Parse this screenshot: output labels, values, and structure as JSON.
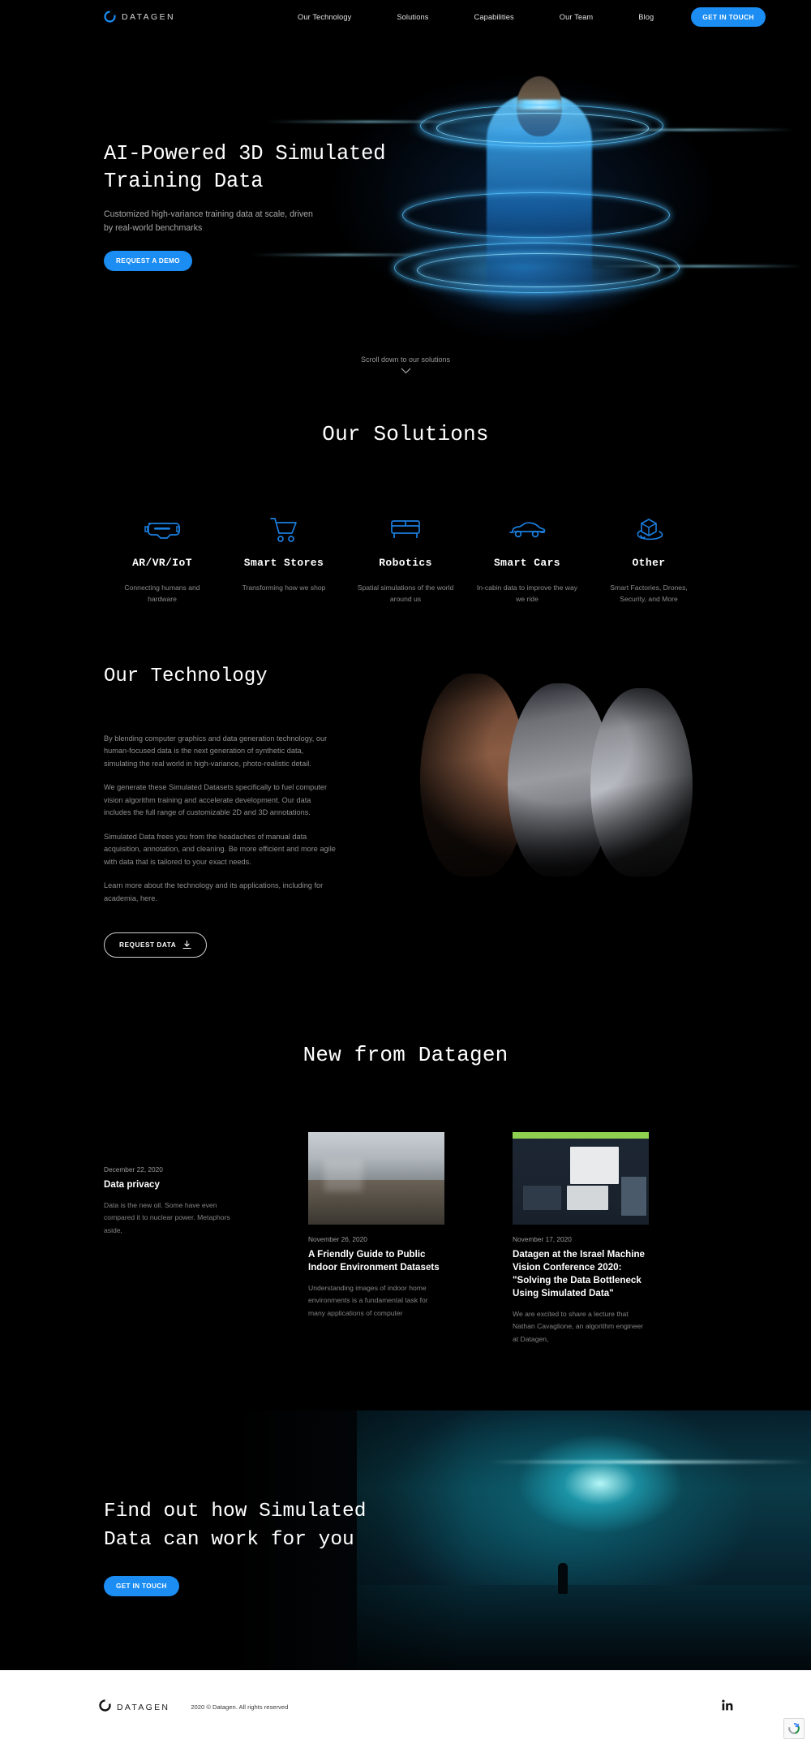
{
  "brand": {
    "name": "DATAGEN",
    "logo_icon": "datagen-ring-logo"
  },
  "nav": {
    "links": [
      {
        "label": "Our Technology"
      },
      {
        "label": "Solutions"
      },
      {
        "label": "Capabilities"
      },
      {
        "label": "Our Team"
      },
      {
        "label": "Blog"
      }
    ],
    "cta_label": "GET IN TOUCH"
  },
  "hero": {
    "title_line1": "AI-Powered 3D Simulated",
    "title_line2": "Training Data",
    "sub_line1": "Customized high-variance training data at scale, driven",
    "sub_line2": "by real-world benchmarks",
    "button_label": "REQUEST A DEMO",
    "scroll_label": "Scroll down to our solutions",
    "scroll_icon": "chevron-down-icon"
  },
  "solutions": {
    "title": "Our Solutions",
    "items": [
      {
        "icon": "vr-headset-icon",
        "name": "AR/VR/IoT",
        "desc": "Connecting humans and hardware"
      },
      {
        "icon": "shopping-cart-icon",
        "name": "Smart Stores",
        "desc": "Transforming how we shop"
      },
      {
        "icon": "sofa-icon",
        "name": "Robotics",
        "desc": "Spatial simulations of the world around us"
      },
      {
        "icon": "car-icon",
        "name": "Smart Cars",
        "desc": "In-cabin data to improve the way we ride"
      },
      {
        "icon": "cube-rotate-icon",
        "name": "Other",
        "desc": "Smart Factories, Drones, Security, and More"
      }
    ]
  },
  "technology": {
    "title": "Our Technology",
    "paragraphs": [
      "By blending computer graphics and data generation technology, our human-focused data is the next generation of synthetic data, simulating the real world in high-variance, photo-realistic detail.",
      "We generate these Simulated Datasets specifically to fuel computer vision algorithm training and accelerate development. Our data includes the full range of customizable 2D and 3D annotations.",
      "Simulated Data frees you from the headaches of manual data acquisition, annotation, and cleaning. Be more efficient and more agile with data that is tailored to your exact needs.",
      "Learn more about the technology and its applications, including for academia, here."
    ],
    "button_label": "REQUEST DATA",
    "button_icon": "download-icon"
  },
  "news": {
    "title": "New from Datagen",
    "cards": [
      {
        "date": "December 22, 2020",
        "title": "Data privacy",
        "excerpt": "Data is the new oil. Some have even compared it to nuclear power. Metaphors aside,",
        "has_thumb": false
      },
      {
        "date": "November 26, 2020",
        "title": "A Friendly Guide to Public Indoor Environment Datasets",
        "excerpt": "Understanding images of indoor home environments is a fundamental task for many applications of computer",
        "has_thumb": true,
        "thumb_kind": "indoor-room-photo"
      },
      {
        "date": "November 17, 2020",
        "title": "Datagen at the Israel Machine Vision Conference 2020: \"Solving the Data Bottleneck Using Simulated Data\"",
        "excerpt": "We are excited to share a lecture that Nathan Cavaglione, an algorithm engineer at Datagen,",
        "has_thumb": true,
        "thumb_kind": "conference-slide-photo"
      }
    ]
  },
  "cta": {
    "title_line1": "Find out how Simulated",
    "title_line2": "Data can work for you",
    "button_label": "GET IN TOUCH"
  },
  "footer": {
    "brand": "DATAGEN",
    "copyright": "2020 © Datagen. All rights reserved",
    "social_icon": "linkedin-icon",
    "recaptcha_icon": "recaptcha-icon"
  },
  "colors": {
    "accent_blue": "#1b8df3",
    "icon_blue": "#1b7fe0",
    "background": "#000000",
    "footer_background": "#ffffff"
  }
}
